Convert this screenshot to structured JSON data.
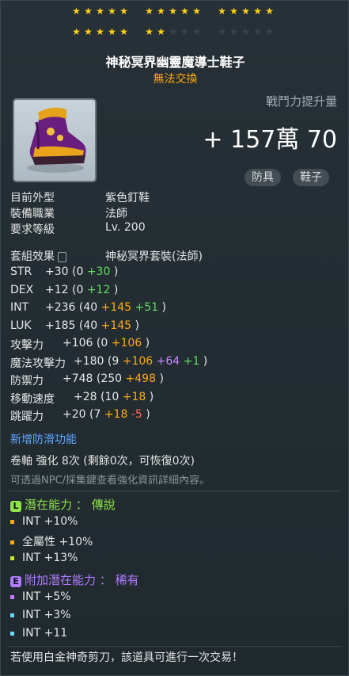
{
  "stars": {
    "rows": [
      {
        "groups": [
          5,
          5,
          5
        ],
        "filled": [
          5,
          5,
          5
        ]
      },
      {
        "groups": [
          5,
          5,
          5
        ],
        "filled": [
          5,
          2,
          0
        ]
      }
    ]
  },
  "item": {
    "name": "神秘冥界幽靈魔導士鞋子",
    "trade": "無法交換",
    "power_label": "戰鬥力提升量",
    "power_value": "+ 157萬 70",
    "tags": [
      "防具",
      "鞋子"
    ]
  },
  "info": [
    {
      "label": "目前外型",
      "value": "紫色釘鞋"
    },
    {
      "label": "裝備職業",
      "value": "法師"
    },
    {
      "label": "要求等級",
      "value": "Lv. 200"
    }
  ],
  "set_effect": {
    "label": "套組效果",
    "value": "神秘冥界套裝(法師)"
  },
  "stats": [
    {
      "name": "STR",
      "total": "+30",
      "base": "0",
      "parts": [
        {
          "v": "+30",
          "c": "green"
        }
      ]
    },
    {
      "name": "DEX",
      "total": "+12",
      "base": "0",
      "parts": [
        {
          "v": "+12",
          "c": "green"
        }
      ]
    },
    {
      "name": "INT",
      "total": "+236",
      "base": "40",
      "parts": [
        {
          "v": "+145",
          "c": "orange"
        },
        {
          "v": "+51",
          "c": "green"
        }
      ]
    },
    {
      "name": "LUK",
      "total": "+185",
      "base": "40",
      "parts": [
        {
          "v": "+145",
          "c": "orange"
        }
      ]
    },
    {
      "name": "攻擊力",
      "total": "+106",
      "base": "0",
      "parts": [
        {
          "v": "+106",
          "c": "orange"
        }
      ]
    },
    {
      "name": "魔法攻擊力",
      "total": "+180",
      "base": "9",
      "parts": [
        {
          "v": "+106",
          "c": "orange"
        },
        {
          "v": "+64",
          "c": "purple"
        },
        {
          "v": "+1",
          "c": "green"
        }
      ]
    },
    {
      "name": "防禦力",
      "total": "+748",
      "base": "250",
      "parts": [
        {
          "v": "+498",
          "c": "orange"
        }
      ]
    },
    {
      "name": "移動速度",
      "total": "+28",
      "base": "10",
      "parts": [
        {
          "v": "+18",
          "c": "orange"
        }
      ]
    },
    {
      "name": "跳躍力",
      "total": "+20",
      "base": "7",
      "parts": [
        {
          "v": "+18",
          "c": "orange"
        },
        {
          "v": "-5",
          "c": "red"
        }
      ]
    }
  ],
  "anti_slip": "新增防滑功能",
  "scroll_line": "卷軸 強化 8次 (剩餘0次，可恢復0次)",
  "scroll_note": "可透過NPC/採集鍵查看強化資訊詳細內容。",
  "potential": {
    "badge": "L",
    "title": "潛在能力",
    "grade": "傳說",
    "lines": [
      {
        "text": "INT +10%",
        "color": "#ffaa11"
      },
      {
        "text": "全屬性 +10%",
        "color": "#ffaa11"
      },
      {
        "text": "INT +13%",
        "color": "#c9e82a"
      }
    ]
  },
  "bonus_potential": {
    "badge": "E",
    "title": "附加潛在能力",
    "grade": "稀有",
    "lines": [
      {
        "text": "INT +5%",
        "color": "#c07bff"
      },
      {
        "text": "INT +3%",
        "color": "#6fd8ff"
      },
      {
        "text": "INT +11",
        "color": "#6fd8ff"
      }
    ]
  },
  "footer": "若使用白金神奇剪刀，該道具可進行一次交易！",
  "colors": {
    "legendary": "#8fe24a",
    "unique": "#b07bff",
    "orange": "#ffaa11",
    "title": "#ffffff"
  }
}
